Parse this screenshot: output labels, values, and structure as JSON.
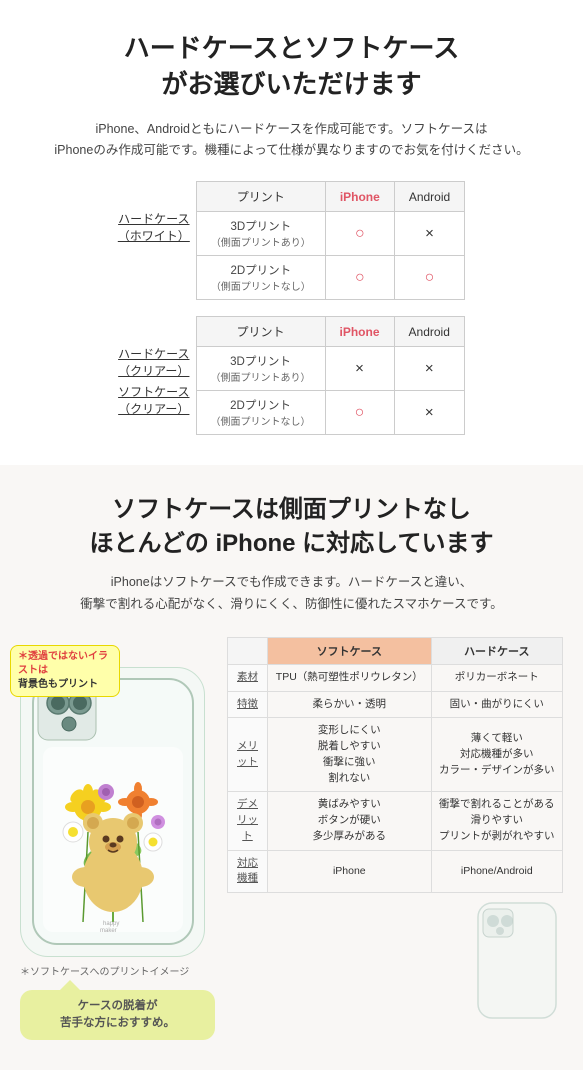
{
  "section1": {
    "title": "ハードケースとソフトケース\nがお選びいただけます",
    "desc": "iPhone、Androidともにハードケースを作成可能です。ソフトケースは\niPhoneのみ作成可能です。機種によって仕様が異なりますのでお気を付けください。",
    "table1": {
      "col_print": "プリント",
      "col_iphone": "iPhone",
      "col_android": "Android",
      "left_label_line1": "ハードケース",
      "left_label_line2": "（ホワイト）",
      "rows": [
        {
          "print": "3Dプリント",
          "sub": "（側面プリントあり）",
          "iphone": "○",
          "android": "×"
        },
        {
          "print": "2Dプリント",
          "sub": "（側面プリントなし）",
          "iphone": "○",
          "android": "○"
        }
      ]
    },
    "table2": {
      "col_print": "プリント",
      "col_iphone": "iPhone",
      "col_android": "Android",
      "left_label1_line1": "ハードケース",
      "left_label1_line2": "（クリアー）",
      "left_label2_line1": "ソフトケース",
      "left_label2_line2": "（クリアー）",
      "rows": [
        {
          "print": "3Dプリント",
          "sub": "（側面プリントあり）",
          "iphone": "×",
          "android": "×"
        },
        {
          "print": "2Dプリント",
          "sub": "（側面プリントなし）",
          "iphone": "○",
          "android": "×"
        }
      ]
    }
  },
  "section2": {
    "title": "ソフトケースは側面プリントなし\nほとんどの iPhone に対応しています",
    "desc": "iPhoneはソフトケースでも作成できます。ハードケースと違い、\n衝撃で割れる心配がなく、滑りにくく、防御性に優れたスマホケースです。",
    "note_bubble_line1": "＊透過ではないイラストは",
    "note_bubble_line2": "背景色もプリント",
    "phone_caption": "＊ソフトケースへのプリントイメージ",
    "callout": "ケースの脱着が\n苦手な方におすすめ。",
    "comp_table": {
      "col_soft": "ソフトケース",
      "col_hard": "ハードケース",
      "rows": [
        {
          "label": "素材",
          "soft": "TPU（熱可塑性ポリウレタン）",
          "hard": "ポリカーボネート"
        },
        {
          "label": "特徴",
          "soft": "柔らかい・透明",
          "hard": "固い・曲がりにくい"
        },
        {
          "label": "メリット",
          "soft": "変形しにくい\n脱着しやすい\n衝撃に強い\n割れない",
          "hard": "薄くて軽い\n対応機種が多い\nカラー・デザインが多い"
        },
        {
          "label": "デメリット",
          "soft": "黄ばみやすい\nボタンが硬い\n多少厚みがある",
          "hard": "衝撃で割れることがある\n滑りやすい\nプリントが剥がれやすい"
        },
        {
          "label": "対応機種",
          "soft": "iPhone",
          "hard": "iPhone/Android"
        }
      ]
    }
  }
}
